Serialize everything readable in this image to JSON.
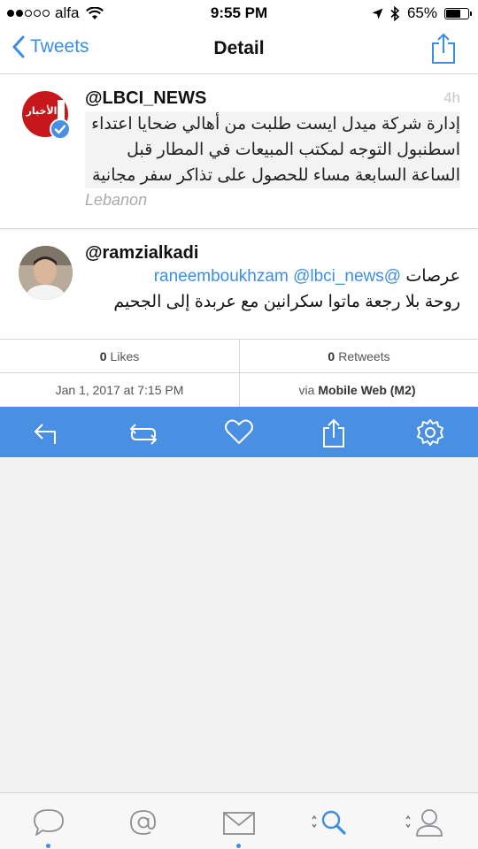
{
  "status_bar": {
    "carrier": "alfa",
    "time": "9:55 PM",
    "battery": "65%",
    "battery_level": 0.65
  },
  "nav": {
    "back_label": "Tweets",
    "title": "Detail"
  },
  "quoted_tweet": {
    "handle": "@LBCI_NEWS",
    "time_ago": "4h",
    "text": "إدارة شركة ميدل ايست طلبت من أهالي ضحايا اعتداء اسطنبول التوجه لمكتب المبيعات في المطار قبل الساعة السابعة مساء للحصول على تذاكر سفر مجانية",
    "location": "Lebanon",
    "avatar_label": "الأخبار"
  },
  "tweet": {
    "handle": "@ramzialkadi",
    "mention_1": "@lbci_news",
    "mention_2": "@raneemboukhzam",
    "text_start": "عرصات",
    "text_rest": "روحة بلا رجعة ماتوا سكرانين مع عربدة إلى الجحيم"
  },
  "stats": {
    "likes_count": "0",
    "likes_label": "Likes",
    "retweets_count": "0",
    "retweets_label": "Retweets",
    "date": "Jan 1, 2017 at 7:15 PM",
    "via_prefix": "via",
    "via_client": "Mobile Web (M2)"
  },
  "action_bar_icons": [
    "reply-icon",
    "retweet-icon",
    "like-icon",
    "share-icon",
    "settings-icon"
  ],
  "tab_bar_icons": [
    "timeline-icon",
    "mentions-icon",
    "messages-icon",
    "search-icon",
    "profile-icon"
  ],
  "colors": {
    "accent": "#3d8ee3",
    "action_bar": "#4a90e2",
    "verified": "#4a90e2",
    "lbci_red": "#d42027"
  }
}
